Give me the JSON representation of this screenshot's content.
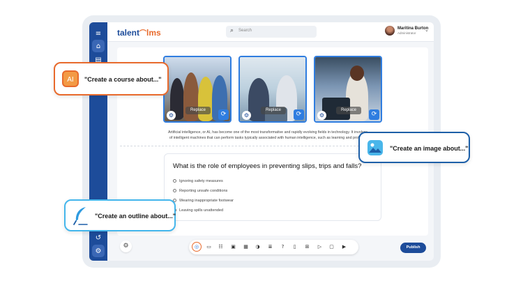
{
  "app": {
    "logo_prefix": "talent",
    "logo_arc": "⌒",
    "logo_suffix": "lms"
  },
  "header": {
    "search_placeholder": "Search",
    "user_name": "Maritina Burton",
    "user_role": "Administrator"
  },
  "sidebar": {
    "top_items": [
      {
        "icon": "menu-icon",
        "glyph": "≡"
      },
      {
        "icon": "home-icon",
        "glyph": "⌂"
      },
      {
        "icon": "book-icon",
        "glyph": "▤"
      }
    ],
    "bottom_items": [
      {
        "icon": "history-icon",
        "glyph": "↺"
      },
      {
        "icon": "settings-icon",
        "glyph": "⚙"
      }
    ]
  },
  "content": {
    "images": [
      {
        "replace_label": "Replace"
      },
      {
        "replace_label": "Replace"
      },
      {
        "replace_label": "Replace"
      }
    ],
    "paragraph_line1": "Artificial intelligence, or AI, has become one of the most transformative and rapidly evolving fields in technology. It involves",
    "paragraph_line2": "of intelligent machines that can perform tasks typically associated with human intelligence, such as learning and problem",
    "quiz": {
      "question": "What is the role of employees in preventing slips, trips and falls?",
      "options": [
        "Ignoring safety measures",
        "Reporting unsafe conditions",
        "Wearing inappropriate footwear",
        "Leaving spills unattended"
      ]
    }
  },
  "toolbar": {
    "icons": [
      "ai-icon",
      "text-icon",
      "list-icon",
      "image-icon",
      "media-icon",
      "quiz-icon",
      "divider-icon",
      "question-icon",
      "document-icon",
      "table-icon",
      "video-icon",
      "file-icon",
      "youtube-icon"
    ],
    "glyphs": [
      "◎",
      "▭",
      "☷",
      "▣",
      "▦",
      "◑",
      "≣",
      "?",
      "▯",
      "⊞",
      "▷",
      "▢",
      "▶"
    ],
    "publish_label": "Publish"
  },
  "callouts": {
    "course_badge": "AI",
    "course_text": "\"Create a course about...\"",
    "image_text": "\"Create an image about...\"",
    "outline_text": "\"Create an outline about...\""
  },
  "colors": {
    "brand_blue": "#1d4c9a",
    "accent_orange": "#e86a2c",
    "image_border": "#2f7de0",
    "callout_cyan": "#44b6ec"
  }
}
